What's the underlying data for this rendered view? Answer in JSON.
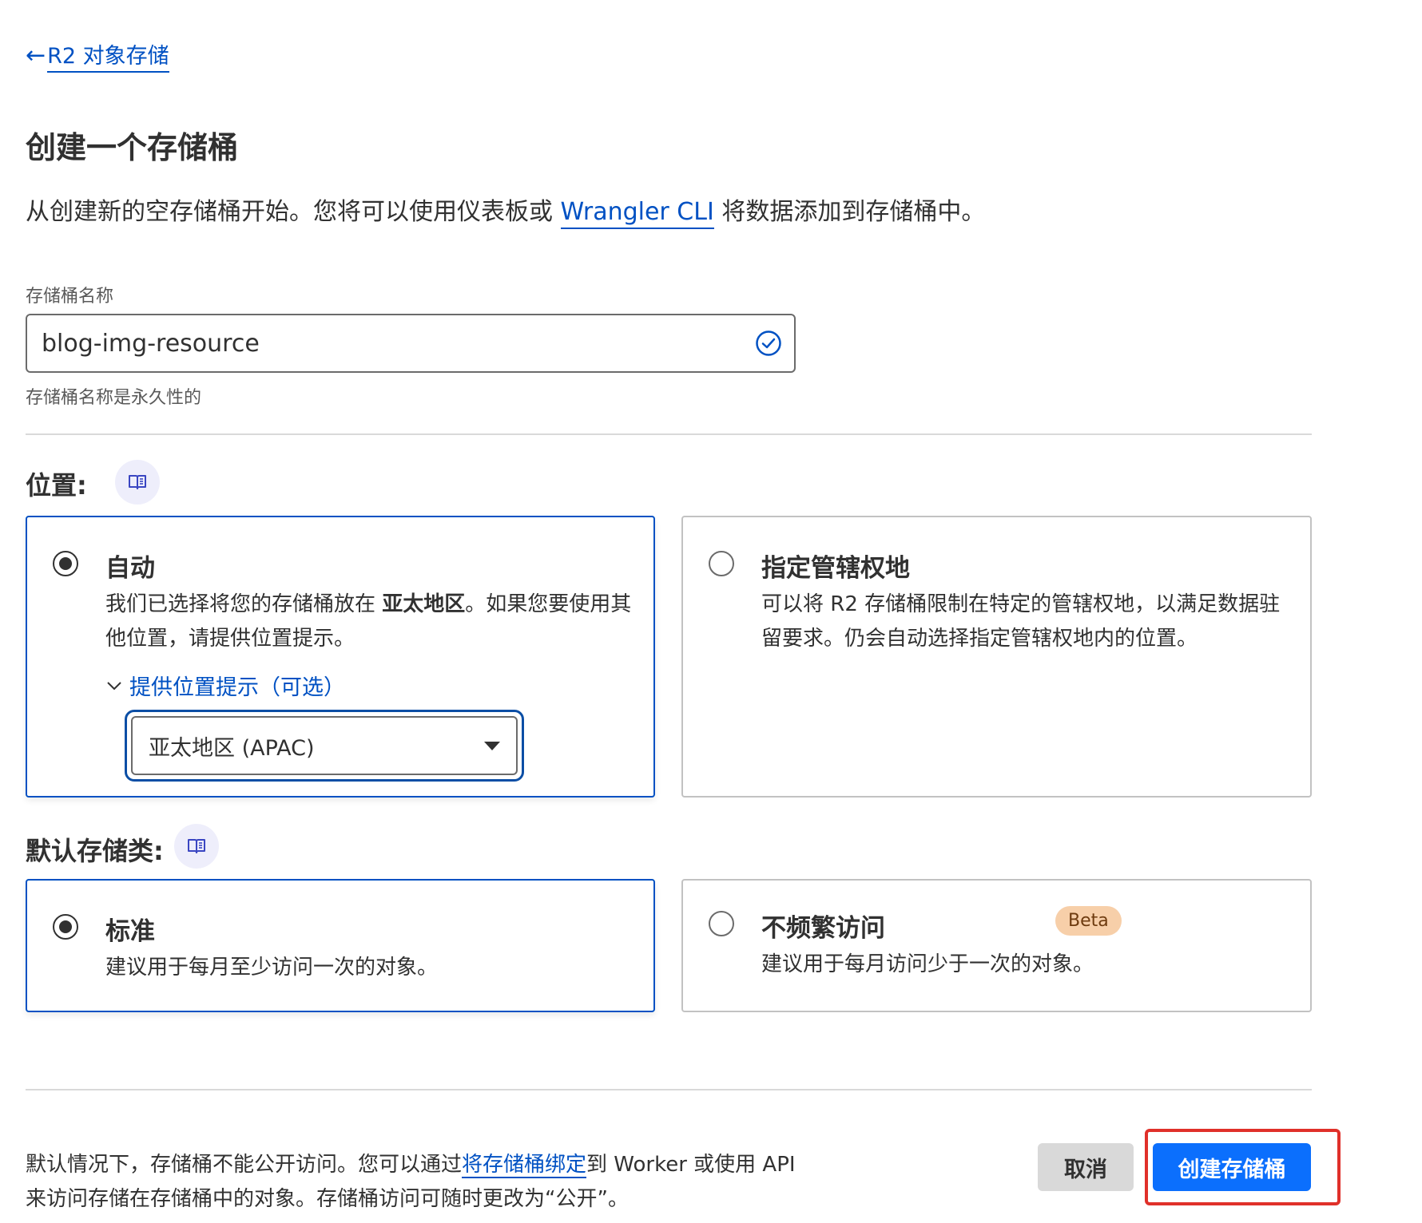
{
  "breadcrumb": {
    "arrow": "←",
    "label": "R2 对象存储"
  },
  "page": {
    "title": "创建一个存储桶",
    "intro_before": "从创建新的空存储桶开始。您将可以使用仪表板或 ",
    "intro_link": "Wrangler CLI",
    "intro_after": " 将数据添加到存储桶中。"
  },
  "bucket_name": {
    "label": "存储桶名称",
    "value": "blog-img-resource",
    "help": "存储桶名称是永久性的",
    "valid_icon": "check-circle-icon"
  },
  "location": {
    "title": "位置:",
    "doc_icon": "book-icon",
    "options": [
      {
        "title": "自动",
        "desc_before": "我们已选择将您的存储桶放在 ",
        "desc_bold": "亚太地区",
        "desc_after": "。如果您要使用其他位置，请提供位置提示。",
        "selected": true
      },
      {
        "title": "指定管辖权地",
        "desc": "可以将 R2 存储桶限制在特定的管辖权地，以满足数据驻留要求。仍会自动选择指定管辖权地内的位置。",
        "selected": false
      }
    ],
    "hint_toggle": "提供位置提示（可选）",
    "hint_select_value": "亚太地区 (APAC)"
  },
  "storage_class": {
    "title": "默认存储类:",
    "doc_icon": "book-icon",
    "options": [
      {
        "title": "标准",
        "desc": "建议用于每月至少访问一次的对象。",
        "selected": true
      },
      {
        "title": "不频繁访问",
        "badge": "Beta",
        "desc": "建议用于每月访问少于一次的对象。",
        "selected": false
      }
    ]
  },
  "footer": {
    "text_before": "默认情况下，存储桶不能公开访问。您可以通过",
    "text_link": "将存储桶绑定",
    "text_line1_after": "到 Worker 或使用 API",
    "text_line2": "来访问存储在存储桶中的对象。存储桶访问可随时更改为“公开”。",
    "cancel_label": "取消",
    "create_label": "创建存储桶"
  },
  "colors": {
    "link": "#0051c3",
    "primary_button": "#0b6ffd",
    "selected_border": "#0051c3",
    "badge_bg": "#f7cfa9",
    "annotation": "#e0302a"
  }
}
